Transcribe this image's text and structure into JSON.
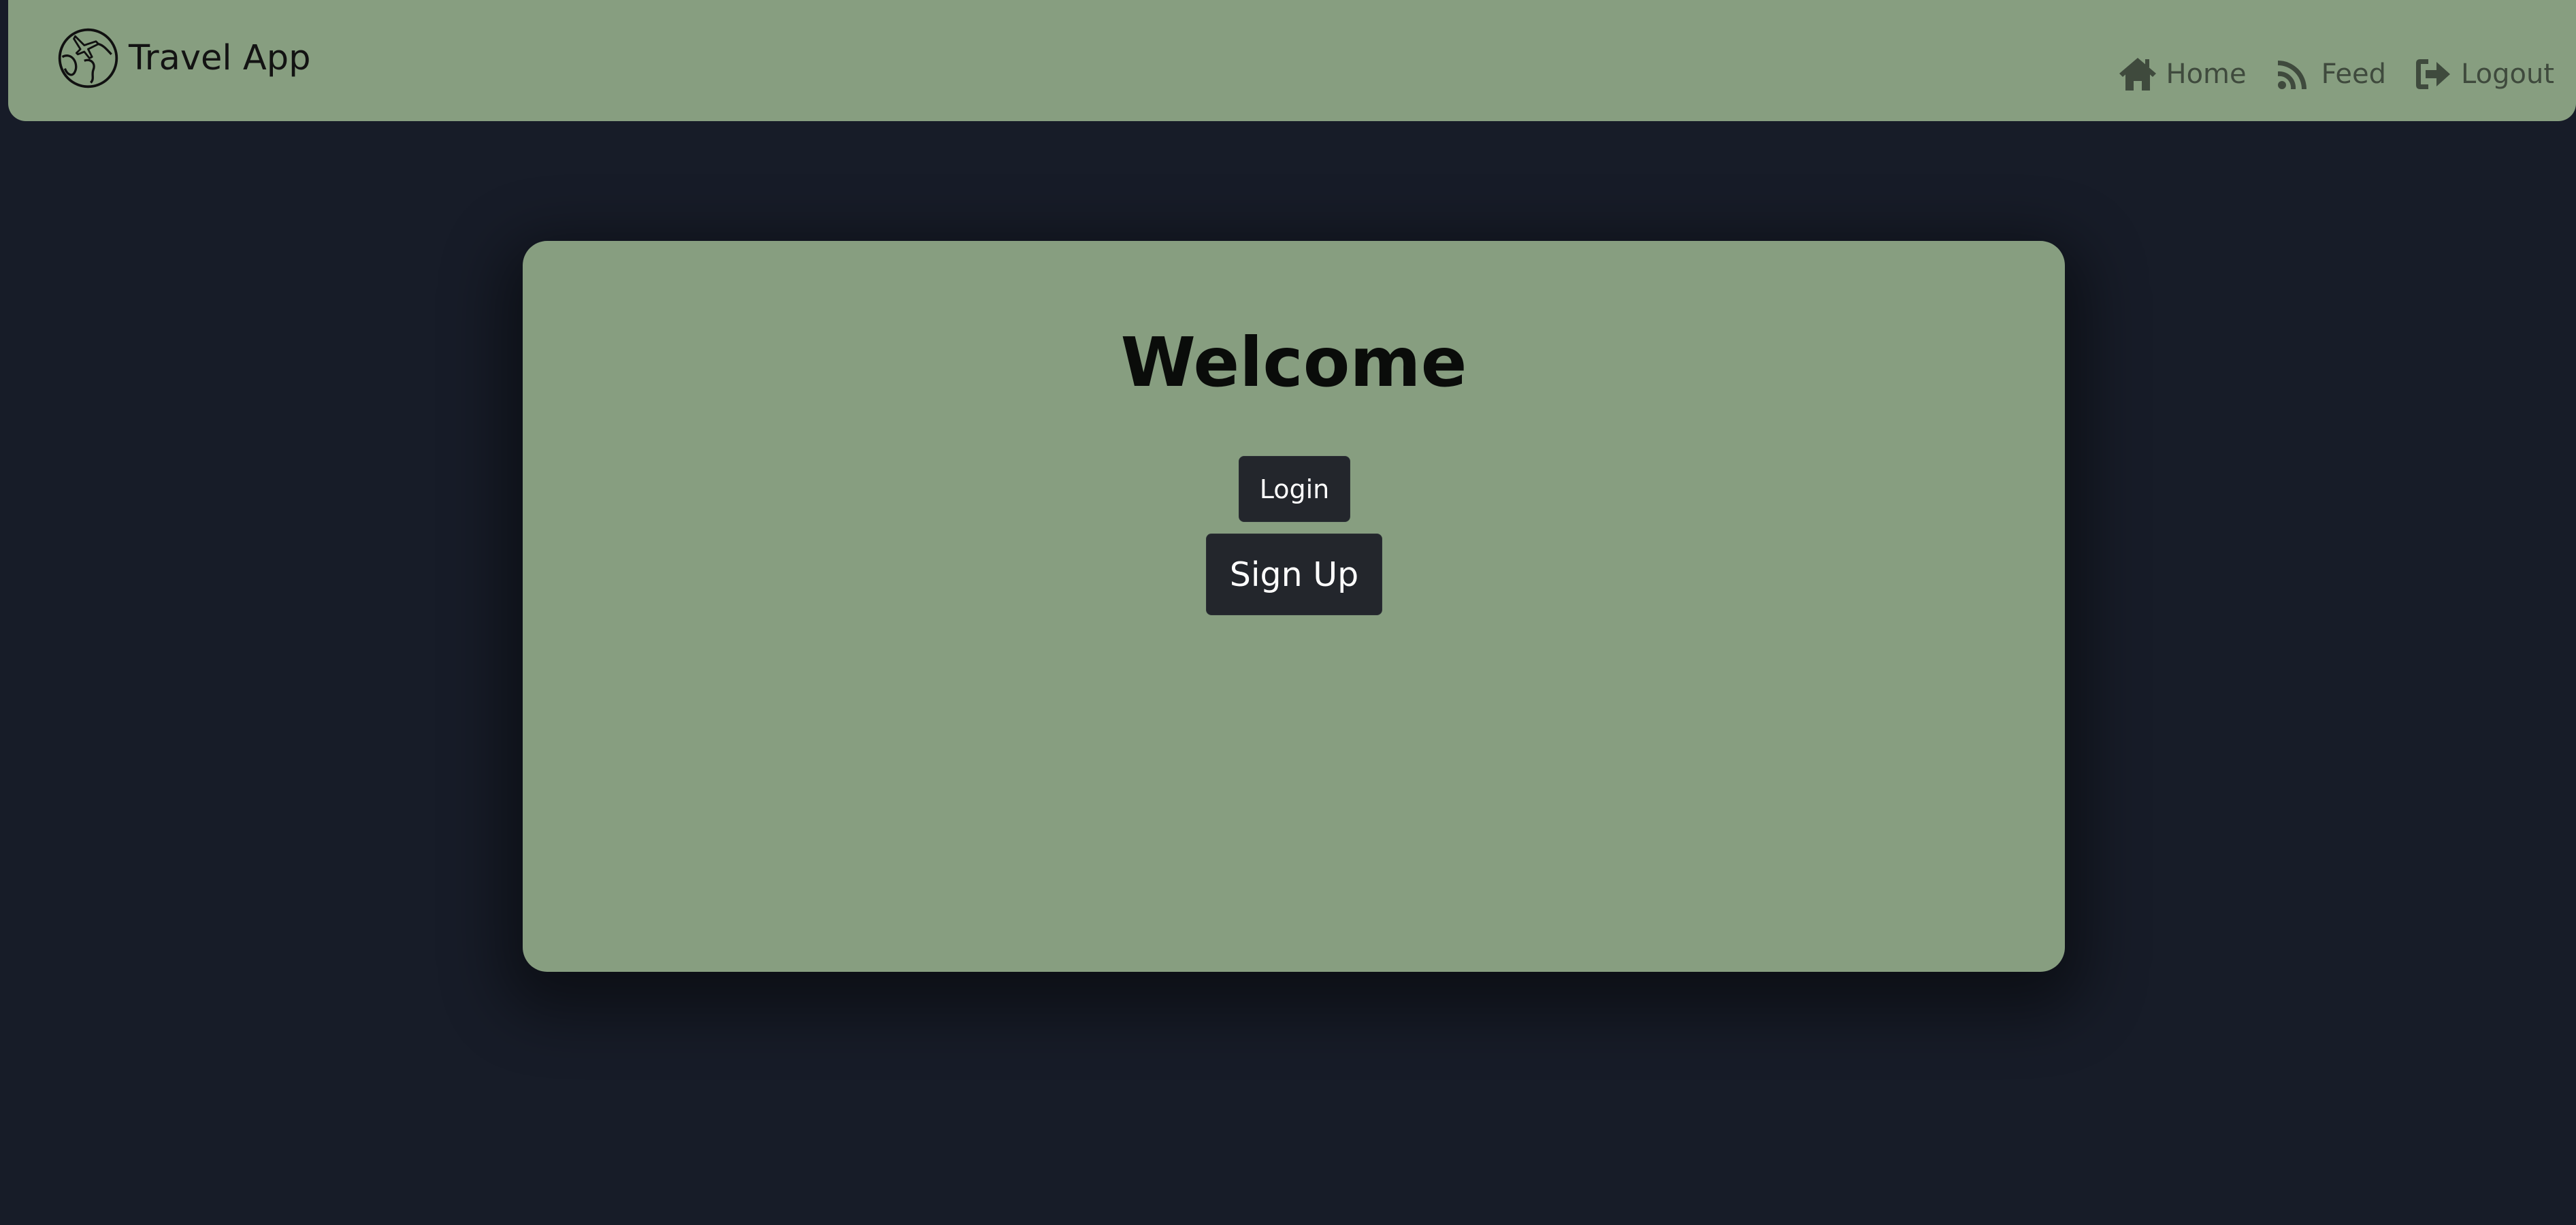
{
  "navbar": {
    "brand_name": "Travel App",
    "brand_logo_icon": "globe-airplane-icon",
    "links": [
      {
        "label": "Home",
        "icon": "home-icon"
      },
      {
        "label": "Feed",
        "icon": "rss-feed-icon"
      },
      {
        "label": "Logout",
        "icon": "logout-icon"
      }
    ]
  },
  "main": {
    "heading": "Welcome",
    "login_label": "Login",
    "signup_label": "Sign Up"
  },
  "colors": {
    "page_background": "#171c28",
    "accent_green": "#879e80",
    "button_dark": "#23262c",
    "nav_text": "#3f4a3d"
  }
}
